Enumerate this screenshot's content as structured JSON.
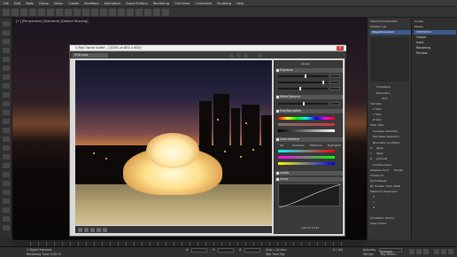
{
  "menu": {
    "items": [
      "File",
      "Edit",
      "Tools",
      "Group",
      "Views",
      "Create",
      "Modifiers",
      "Animation",
      "Graph Editors",
      "Rendering",
      "Civil View",
      "Customize",
      "Scripting",
      "Help"
    ]
  },
  "viewport": {
    "label": "[+] [Perspective] [Standard] [Default Shading]"
  },
  "vfb": {
    "title": "V-Ray frame buffer - [100% of 800 x 600]",
    "channel_select": "RGB color",
    "close_glyph": "✕",
    "panel": {
      "title": "Global",
      "sections": [
        {
          "label": "Exposure"
        },
        {
          "label": "White Balance"
        },
        {
          "label": "Hue/Saturation"
        },
        {
          "label": "Color balance"
        },
        {
          "label": "Levels"
        },
        {
          "label": "Curve"
        }
      ],
      "balance_tabs": [
        "All",
        "Shadows",
        "Midtones",
        "Highlights"
      ],
      "coords": "(18,27)  0.512"
    }
  },
  "rpanel": {
    "object_name": "VRayVolumeGrid001",
    "modifier_list": "Modifier List",
    "stack_item": "VRayVolumeGrid",
    "rollouts": [
      "Simulation",
      "Preview",
      "Rendering",
      "Explorer"
    ],
    "sim_label": "Simulation",
    "resolution_label": "Resolution",
    "grid_label": "Grid",
    "cell_size_label": "Cell size:",
    "xsize_label": "X Size:",
    "ysize_label": "Y Size:",
    "zsize_label": "Z Size:",
    "total_cells_label": "Total cells:",
    "inc_res": "Increase resolution",
    "dec_res": "Decrease resolution",
    "boundary_label": "Boundary conditions",
    "x_label": "X",
    "y_label": "Y",
    "z_label": "Z",
    "open1": "Open",
    "open2": "Open",
    "jammed": "Jammed",
    "confine_label": "Confine Geom",
    "adaptive_label": "Adaptive Grid:",
    "adaptive_val": "Smoke",
    "threshold_label": "Threshold:",
    "extra_margin": "Extra Margin",
    "no_smaller": "No Smaller Than Initial",
    "max_exp": "Maximum Expansion",
    "x_item": "X",
    "y_item": "Y",
    "z_item": "Z",
    "create_label": "Create",
    "modify_label": "Modify",
    "cmd_tabs": [
      "Interaction",
      "Output",
      "Input",
      "Rendering",
      "Preview"
    ],
    "simulation_history": "Simulation History",
    "open_cache": "Open Cache"
  },
  "status": {
    "selected": "1 Object Selected",
    "rendering_time": "Rendering Time: 0:00:21",
    "frame": "0 / 100",
    "x_label": "X:",
    "y_label": "Y:",
    "z_label": "Z:",
    "grid_label": "Grid = 10.0cm",
    "add_time_tag": "Add Time Tag",
    "autokey": "Auto Key",
    "selected_btn": "Selected",
    "set_key": "Set Key",
    "key_filters": "Key Filters..."
  },
  "colors": {
    "accent": "#3b5b8a",
    "close": "#d04040"
  }
}
